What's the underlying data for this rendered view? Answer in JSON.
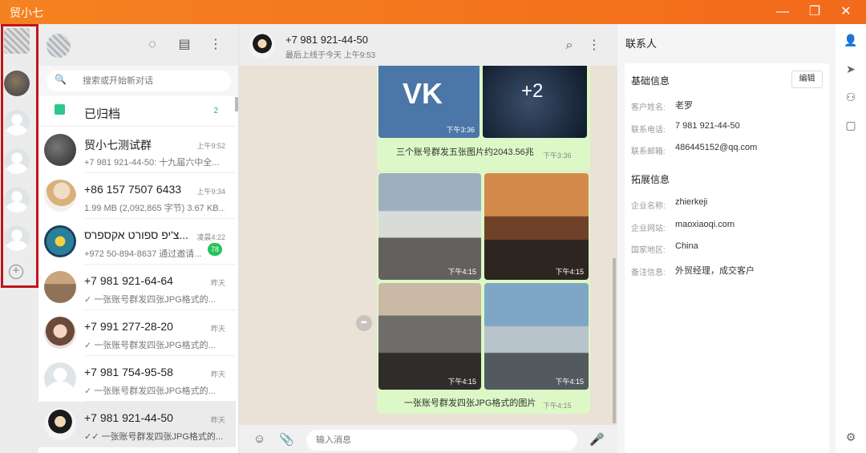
{
  "window": {
    "title": "贸小七"
  },
  "chat_list": {
    "search_placeholder": "搜索或开始新对话",
    "archived": {
      "label": "已归档",
      "count": "2"
    },
    "items": [
      {
        "name": "贸小七测试群",
        "time": "上午9:52",
        "preview": "+7 981 921-44-50: 十九届六中全..."
      },
      {
        "name": "+86 157 7507 6433",
        "time": "上午9:34",
        "preview": "1.99 MB (2,092,865 字节) 3.67 KB..."
      },
      {
        "name": "צ'יפ ספורט אקספרס...",
        "time": "凌晨4:22",
        "preview": "+972 50-894-8637 通过邀请...",
        "badge": "78"
      },
      {
        "name": "+7 981 921-64-64",
        "time": "昨天",
        "preview": "✓ 一张账号群发四张JPG格式的..."
      },
      {
        "name": "+7 991 277-28-20",
        "time": "昨天",
        "preview": "✓ 一张账号群发四张JPG格式的..."
      },
      {
        "name": "+7 981 754-95-58",
        "time": "昨天",
        "preview": "✓ 一张账号群发四张JPG格式的..."
      },
      {
        "name": "+7 981 921-44-50",
        "time": "昨天",
        "preview": "✓✓ 一张账号群发四张JPG格式的..."
      }
    ]
  },
  "chat": {
    "name": "+7 981 921-44-50",
    "status": "最后上线于今天 上午9:53",
    "messages": [
      {
        "images": [
          {
            "label": "VK",
            "time": "下午3:36"
          },
          {
            "label": "+2",
            "time": ""
          }
        ],
        "caption": "三个账号群发五张图片约2043.56兆",
        "time": "下午3:36"
      },
      {
        "images": [
          {
            "time": "下午4:15"
          },
          {
            "time": "下午4:15"
          },
          {
            "time": "下午4:15"
          },
          {
            "time": "下午4:15"
          }
        ],
        "caption": "一张账号群发四张JPG格式的图片",
        "time": "下午4:15"
      }
    ],
    "composer_placeholder": "输入消息"
  },
  "contact": {
    "title": "联系人",
    "basic_title": "基础信息",
    "edit_label": "编辑",
    "basic": [
      {
        "label": "客户姓名:",
        "value": "老罗"
      },
      {
        "label": "联系电话:",
        "value": "7 981 921-44-50"
      },
      {
        "label": "联系邮箱:",
        "value": "486445152@qq.com"
      }
    ],
    "ext_title": "拓展信息",
    "ext": [
      {
        "label": "企业名称:",
        "value": "zhierkeji"
      },
      {
        "label": "企业网站:",
        "value": "maoxiaoqi.com"
      },
      {
        "label": "国家地区:",
        "value": "China"
      },
      {
        "label": "备注信息:",
        "value": "外贸经理，成交客户"
      }
    ]
  },
  "colors": {
    "accent": "#f58220",
    "bubble": "#dcf8c6",
    "highlight_frame": "#c0161a",
    "badge": "#25c35a"
  },
  "icons": [
    "refresh-icon",
    "new-chat-icon",
    "menu-icon",
    "search-icon",
    "archive-icon",
    "emoji-icon",
    "attach-icon",
    "mic-icon",
    "person-icon",
    "send-icon",
    "contacts-icon",
    "notes-icon",
    "settings-icon",
    "forward-icon"
  ]
}
